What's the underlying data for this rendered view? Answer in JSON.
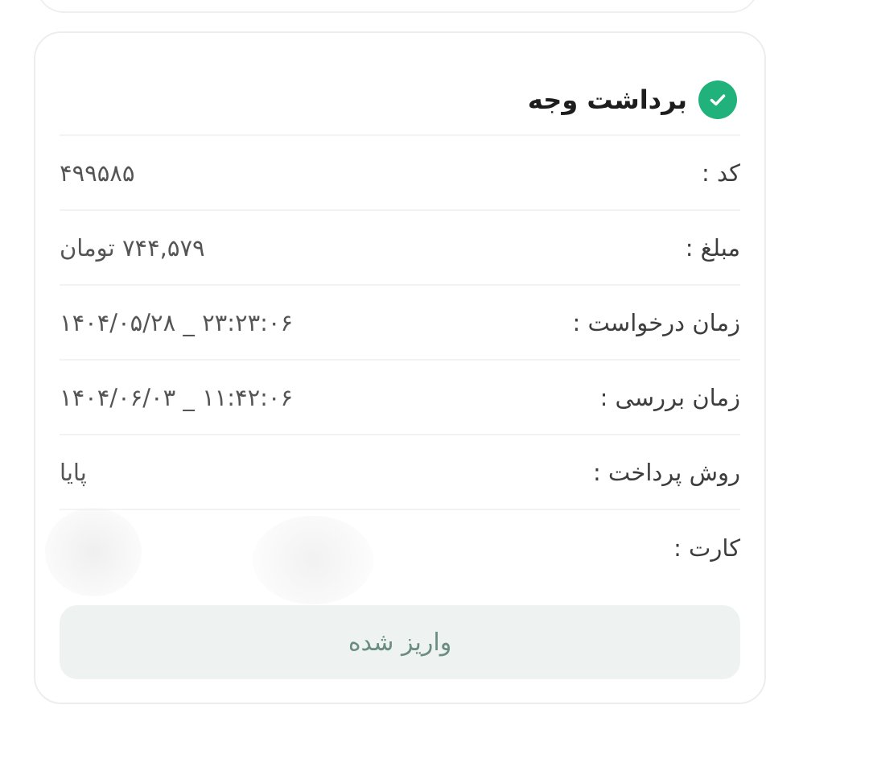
{
  "card": {
    "title": "برداشت وجه",
    "title_icon": "check-circle-icon",
    "accent_color": "#20b27a",
    "rows": [
      {
        "label": "کد :",
        "value": "۴۹۹۵۸۵"
      },
      {
        "label": "مبلغ :",
        "value": "۷۴۴,۵۷۹ تومان"
      },
      {
        "label": "زمان درخواست :",
        "value": "۱۴۰۴/۰۵/۲۸ _ ۲۳:۲۳:۰۶"
      },
      {
        "label": "زمان بررسی :",
        "value": "۱۴۰۴/۰۶/۰۳ _ ۱۱:۴۲:۰۶"
      },
      {
        "label": "روش پرداخت :",
        "value": "پایا"
      },
      {
        "label": "کارت :",
        "value": ""
      }
    ],
    "status_label": "واریز شده"
  }
}
